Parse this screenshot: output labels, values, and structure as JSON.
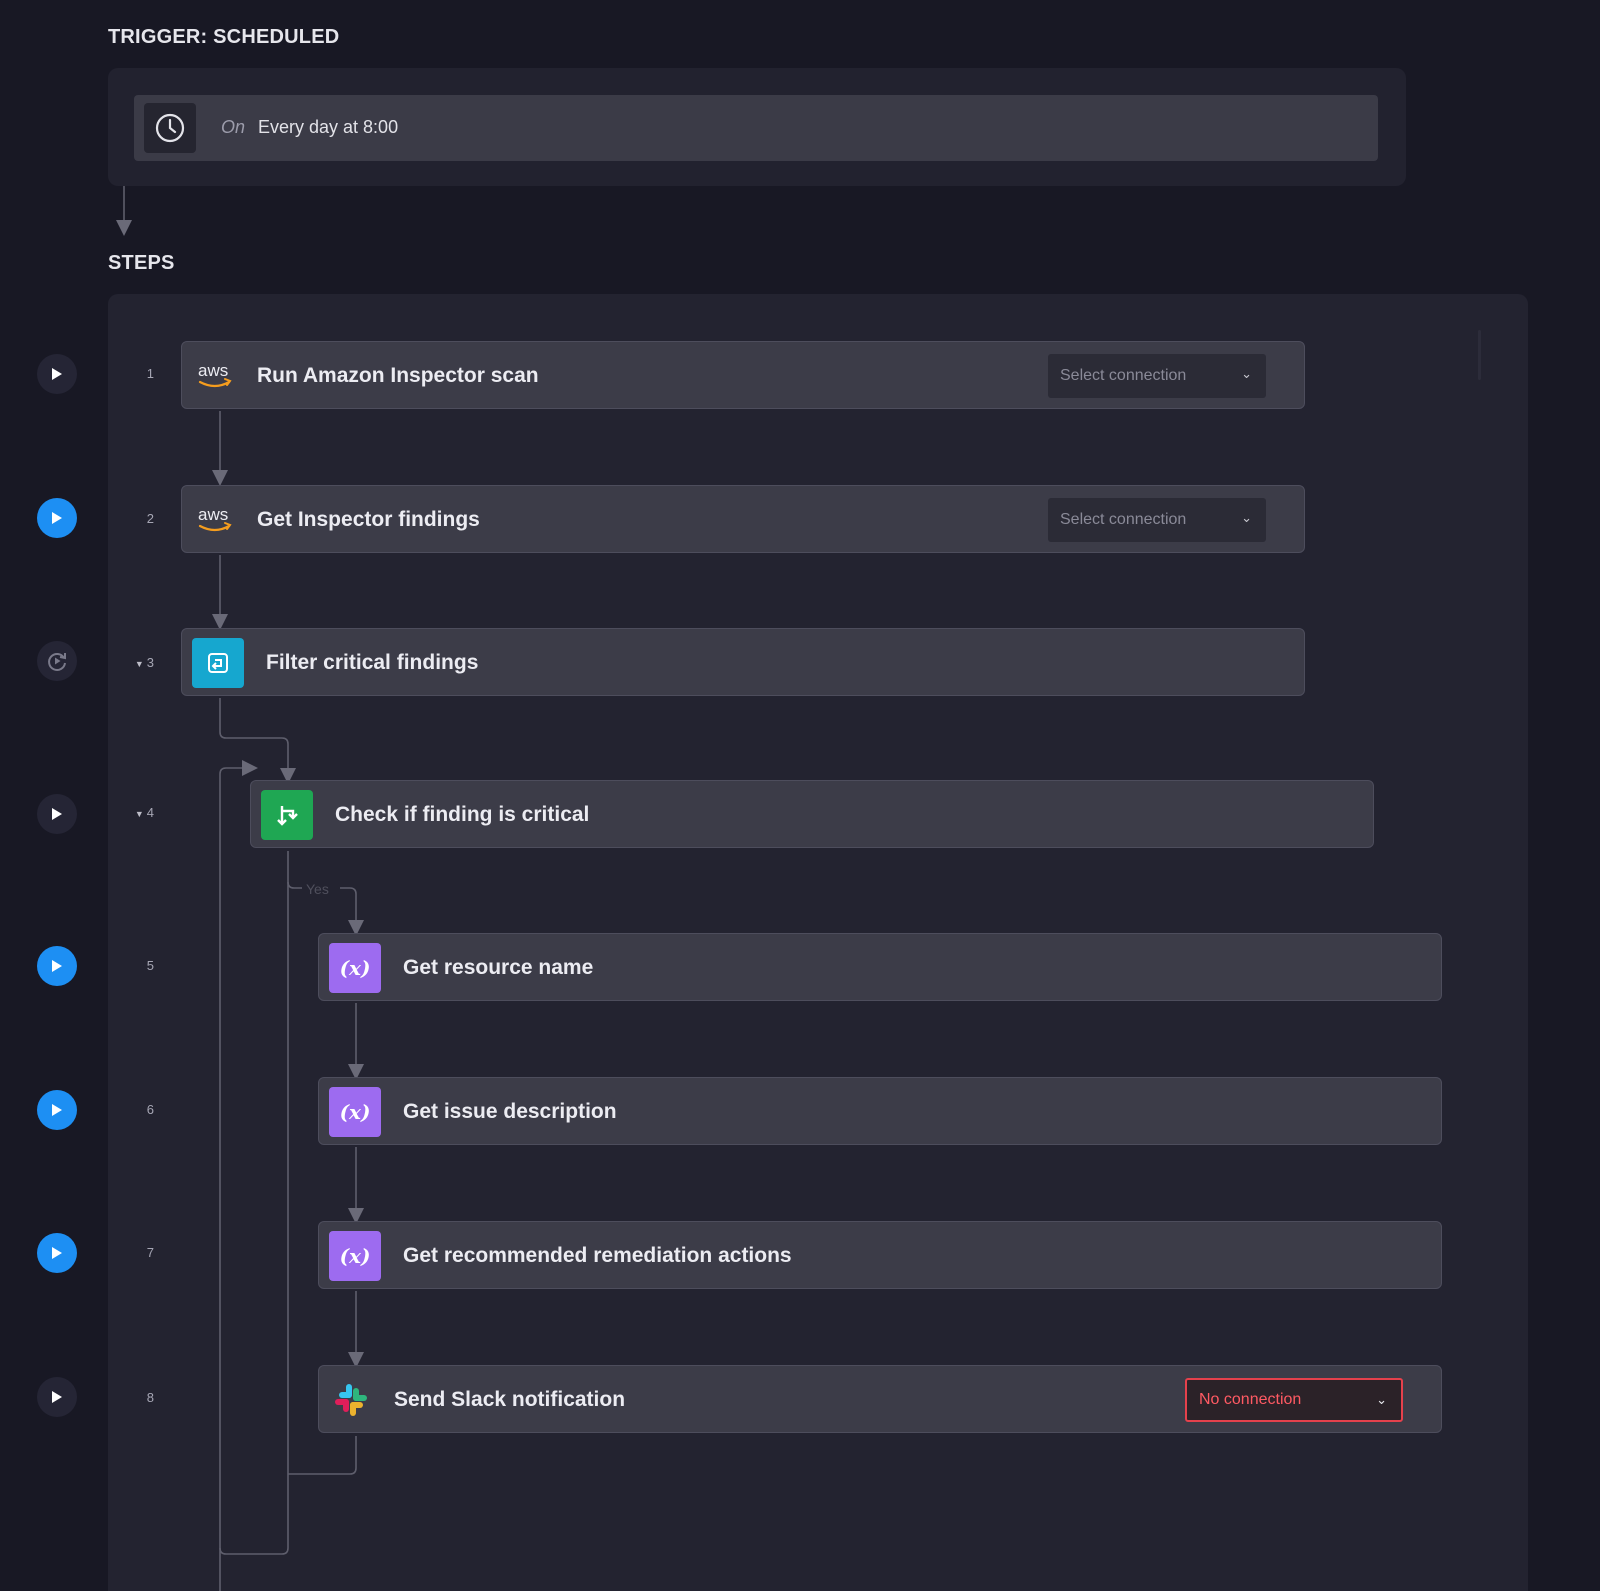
{
  "trigger": {
    "section_title": "TRIGGER: SCHEDULED",
    "on_label": "On",
    "schedule": "Every day at 8:00",
    "icon": "clock-icon"
  },
  "steps_section": {
    "title": "STEPS",
    "branch_label": "Yes",
    "steps": [
      {
        "number": "1",
        "title": "Run Amazon Inspector scan",
        "icon": "aws-logo",
        "connection": "Select connection"
      },
      {
        "number": "2",
        "title": "Get Inspector findings",
        "icon": "aws-logo",
        "connection": "Select connection"
      },
      {
        "number": "3",
        "title": "Filter critical findings",
        "icon": "loop-icon"
      },
      {
        "number": "4",
        "title": "Check if finding is critical",
        "icon": "branch-icon"
      },
      {
        "number": "5",
        "title": "Get resource name",
        "icon": "variable-icon",
        "icon_text": "(x)"
      },
      {
        "number": "6",
        "title": "Get issue description",
        "icon": "variable-icon",
        "icon_text": "(x)"
      },
      {
        "number": "7",
        "title": "Get recommended remediation actions",
        "icon": "variable-icon",
        "icon_text": "(x)"
      },
      {
        "number": "8",
        "title": "Send Slack notification",
        "icon": "slack-logo",
        "connection": "No connection"
      }
    ]
  },
  "colors": {
    "background": "#181824",
    "panel": "#232330",
    "card": "#3c3c48",
    "play_active": "#1d8ff3",
    "loop_icon": "#16a7cf",
    "branch_icon": "#1fa753",
    "variable_icon": "#9d6bf0",
    "error": "#e5414c"
  }
}
